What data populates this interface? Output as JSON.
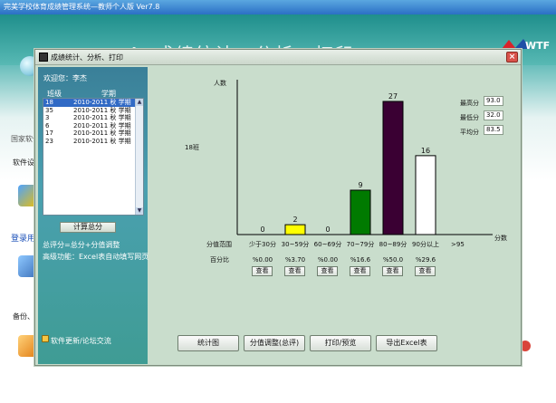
{
  "background": {
    "title": "完美学校体育成绩管理系统—教师个人版  Ver7.8",
    "banner_title": "4. 成绩统计、分析、打印",
    "side_texts": [
      "国家软件",
      "软件设置",
      "登录用",
      "备份、"
    ],
    "logo_text": "WTF"
  },
  "dialog": {
    "title": "成绩统计、分析、打印",
    "close_label": "×"
  },
  "left": {
    "welcome": "欢迎您：李杰",
    "col_class": "班级",
    "col_term": "学期",
    "rows": [
      {
        "class": "18",
        "term": "2010-2011 秋 学期",
        "selected": true
      },
      {
        "class": "35",
        "term": "2010-2011 秋 学期",
        "selected": false
      },
      {
        "class": "3",
        "term": "2010-2011 秋 学期",
        "selected": false
      },
      {
        "class": "6",
        "term": "2010-2011 秋 学期",
        "selected": false
      },
      {
        "class": "17",
        "term": "2010-2011 秋 学期",
        "selected": false
      },
      {
        "class": "23",
        "term": "2010-2011 秋 学期",
        "selected": false
      }
    ],
    "calc_button": "计算总分",
    "formula": "总评分=总分+分值调整",
    "advanced": "高级功能：Excel表自动填写网页",
    "forum_link": "软件更新/论坛交流"
  },
  "chart_data": {
    "type": "bar",
    "class_label": "18班",
    "ylabel": "人数",
    "xlabel": "分数",
    "range_row_label": "分值范围",
    "percent_row_label": "百分比",
    "beyond_label": ">95",
    "categories": [
      "少于30分",
      "30~59分",
      "60~69分",
      "70~79分",
      "80~89分",
      "90分以上"
    ],
    "values": [
      0,
      2,
      0,
      9,
      27,
      16
    ],
    "percents": [
      "%0.00",
      "%3.70",
      "%0.00",
      "%16.6",
      "%50.0",
      "%29.6"
    ],
    "colors": [
      "#ffffff",
      "#ffff00",
      "#ffffff",
      "#007a00",
      "#3a0033",
      "#ffffff"
    ],
    "ylim": [
      0,
      27
    ],
    "view_label": "查看"
  },
  "stats": [
    {
      "label": "最高分",
      "value": "93.0"
    },
    {
      "label": "最低分",
      "value": "32.0"
    },
    {
      "label": "平均分",
      "value": "83.5"
    }
  ],
  "buttons": {
    "chart": "统计图",
    "adjust": "分值调整(总评)",
    "print": "打印/预览",
    "export": "导出Excel表"
  }
}
